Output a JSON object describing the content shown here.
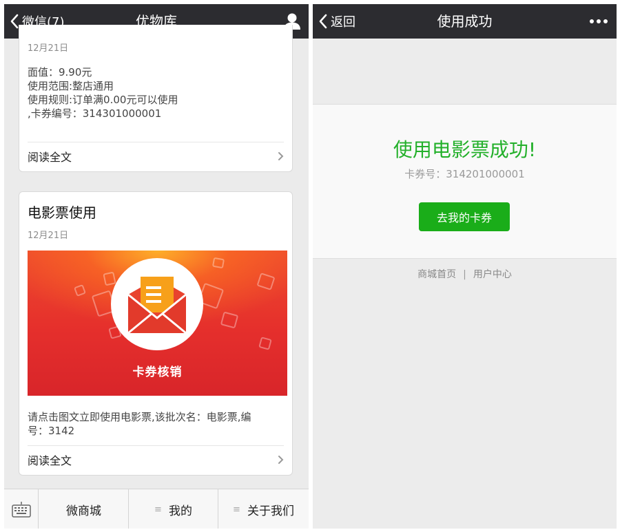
{
  "left": {
    "nav": {
      "back_label": "微信(7)",
      "title": "优物库",
      "right_icon": "person-icon"
    },
    "card1": {
      "date": "12月21日",
      "lines": [
        "面值：9.90元",
        "使用范围:整店通用",
        "使用规则:订单满0.00元可以使用",
        ",卡券编号：314301000001"
      ],
      "read_more": "阅读全文"
    },
    "card2": {
      "title": "电影票使用",
      "date": "12月21日",
      "banner_label": "卡券核销",
      "desc_lines": [
        "请点击图文立即使用电影票,该批次名：电影票,编",
        "号：3142"
      ],
      "read_more": "阅读全文"
    },
    "tabbar": {
      "keyboard_icon": "keyboard-icon",
      "tabs": [
        {
          "label": "微商城",
          "has_menu": false
        },
        {
          "label": "我的",
          "has_menu": true
        },
        {
          "label": "关于我们",
          "has_menu": true
        }
      ],
      "menu_glyph": "≡"
    }
  },
  "right": {
    "nav": {
      "back_label": "返回",
      "title": "使用成功",
      "right_icon": "more-icon"
    },
    "success": {
      "title": "使用电影票成功!",
      "card_no": "卡券号：314201000001",
      "button_label": "去我的卡券"
    },
    "footer": {
      "link1": "商城首页",
      "separator": "|",
      "link2": "用户中心"
    }
  },
  "colors": {
    "nav_bg": "#2c2c30",
    "accent_green": "#1aad19",
    "success_text": "#23b02a",
    "banner_red": "#e52f2c",
    "banner_orange": "#ffb428"
  }
}
